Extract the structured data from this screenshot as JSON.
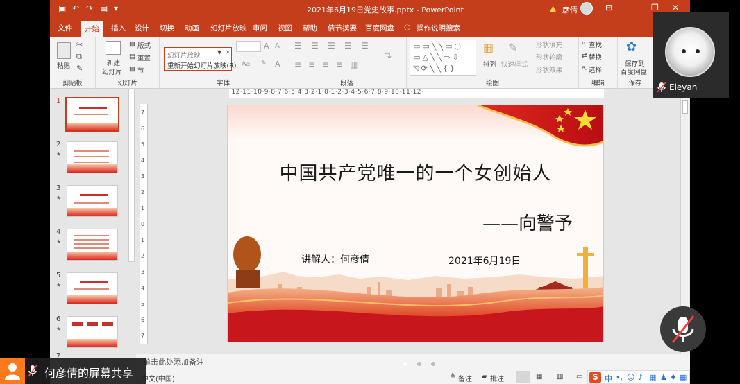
{
  "window": {
    "title": "2021年6月19日党史故事.pptx  -  PowerPoint",
    "user": "彦倩",
    "colors": {
      "accent": "#c43e1c",
      "ribbon_bg": "#f3f3f3",
      "app_bg": "#e6e6e6"
    }
  },
  "tabs": [
    "文件",
    "开始",
    "插入",
    "设计",
    "切换",
    "动画",
    "幻灯片放映",
    "审阅",
    "视图",
    "帮助",
    "倩节摸要",
    "百度网盘",
    "操作说明搜索"
  ],
  "active_tab": "开始",
  "ribbon": {
    "clipboard": {
      "paste": "粘贴",
      "group": "剪贴板"
    },
    "slides": {
      "new_slide_line1": "新建",
      "new_slide_line2": "幻灯片",
      "layout": "版式",
      "reset": "重置",
      "section": "节",
      "group": "幻灯片"
    },
    "slideshow_dropdown": {
      "header": "幻灯片放映",
      "item": "重新开始幻灯片放映(R)"
    },
    "font": {
      "group": "字体"
    },
    "paragraph": {
      "group": "段落"
    },
    "drawing": {
      "arrange": "排列",
      "quick_styles": "快速样式",
      "shape_fill": "形状填充",
      "shape_outline": "形状轮廓",
      "shape_effects": "形状效果",
      "group": "绘图"
    },
    "editing": {
      "find": "查找",
      "replace": "替换",
      "select": "选择",
      "group": "编辑"
    },
    "save": {
      "line1": "保存到",
      "line2": "百度网盘",
      "group": "保存"
    }
  },
  "ruler": {
    "horizontal": "·12·11·10·9·8·7·6·5·4·3·2·1·0·1·2·3·4·5·6·7·8·9·10·11·12·",
    "vertical": [
      "7",
      "6",
      "5",
      "4",
      "3",
      "2",
      "1",
      "0",
      "1",
      "2",
      "3",
      "4",
      "5",
      "6",
      "7"
    ]
  },
  "thumbnails": [
    {
      "num": "1",
      "star": ""
    },
    {
      "num": "2",
      "star": "★"
    },
    {
      "num": "3",
      "star": "★"
    },
    {
      "num": "4",
      "star": "★"
    },
    {
      "num": "5",
      "star": "★"
    },
    {
      "num": "6",
      "star": "★"
    },
    {
      "num": "7",
      "star": ""
    }
  ],
  "slide": {
    "title": "中国共产党唯一的一个女创始人",
    "subtitle": "——向警予",
    "presenter": "讲解人：何彦倩",
    "date": "2021年6月19日"
  },
  "notes_placeholder": "单击此处添加备注",
  "statusbar": {
    "language": "中文(中国)",
    "notes": "备注",
    "comments": "批注"
  },
  "ime": {
    "logo": "S",
    "mode": "中"
  },
  "webcam": {
    "name": "Eleyan"
  },
  "share_bar": {
    "label": "何彦倩的屏幕共享"
  }
}
